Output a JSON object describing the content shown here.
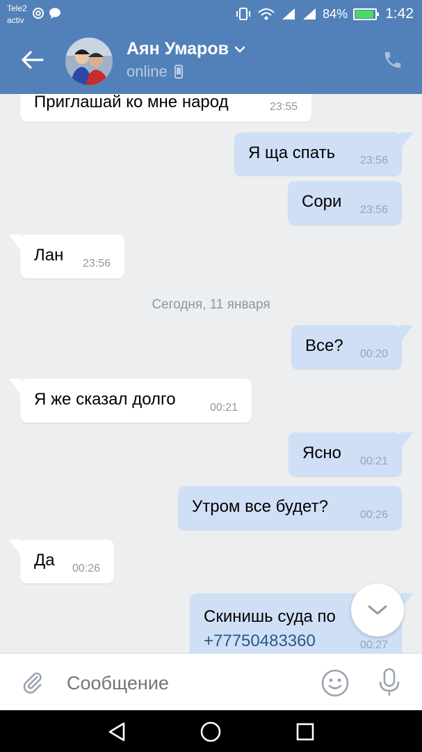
{
  "status_bar": {
    "carrier_line1": "Tele2",
    "carrier_line2": "activ",
    "battery": "84%",
    "time": "1:42",
    "icons": [
      "at-icon",
      "chat-bubble-icon",
      "vibrate-icon",
      "wifi-icon",
      "signal-icon",
      "signal-icon",
      "battery-icon"
    ]
  },
  "header": {
    "contact_name": "Аян Умаров",
    "presence": "online",
    "icons": [
      "back-arrow-icon",
      "chevron-down-icon",
      "mobile-icon",
      "phone-icon"
    ]
  },
  "messages": [
    {
      "direction": "in",
      "text": "Приглашай ко мне народ",
      "time": "23:55"
    },
    {
      "direction": "out",
      "text": "Я ща спать",
      "time": "23:56"
    },
    {
      "direction": "out",
      "text": "Сори",
      "time": "23:56"
    },
    {
      "direction": "in",
      "text": "Лан",
      "time": "23:56"
    },
    {
      "direction": "out",
      "text": "Все?",
      "time": "00:20"
    },
    {
      "direction": "in",
      "text": "Я же сказал долго",
      "time": "00:21"
    },
    {
      "direction": "out",
      "text": "Ясно",
      "time": "00:21"
    },
    {
      "direction": "out",
      "text": "Утром все будет?",
      "time": "00:26"
    },
    {
      "direction": "in",
      "text": "Да",
      "time": "00:26"
    },
    {
      "direction": "out",
      "text": "Скинишь суда по",
      "link": "+77750483360",
      "time": "00:27"
    }
  ],
  "date_separator": "Сегодня, 11 января",
  "composer": {
    "placeholder": "Сообщение",
    "icons": [
      "paperclip-icon",
      "emoji-icon",
      "microphone-icon"
    ]
  },
  "colors": {
    "header": "#5181b8",
    "chat_background": "#edeef0",
    "incoming_bubble": "#ffffff",
    "outgoing_bubble": "#cfe0f6",
    "link": "#2a5885"
  }
}
